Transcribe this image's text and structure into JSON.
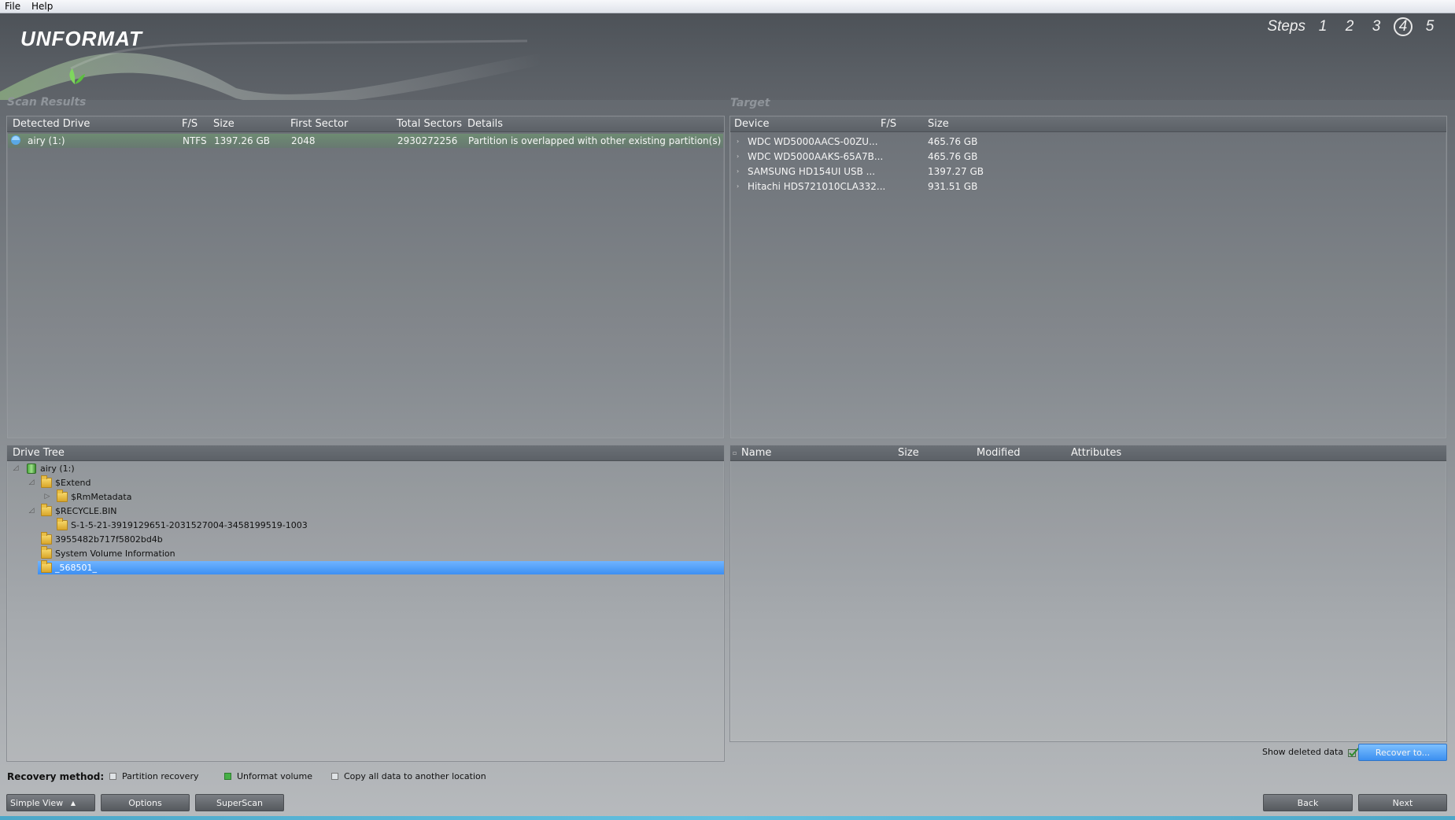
{
  "menu": {
    "file": "File",
    "help": "Help"
  },
  "header": {
    "logo": "UNFORMAT",
    "steps_label": "Steps",
    "steps": [
      "1",
      "2",
      "3",
      "4",
      "5"
    ],
    "current_step": "4"
  },
  "scan_results": {
    "title": "Scan Results",
    "columns": [
      "Detected Drive",
      "F/S",
      "Size",
      "First Sector",
      "Total Sectors",
      "Details"
    ],
    "rows": [
      {
        "drive": "airy (1:)",
        "fs": "NTFS",
        "size": "1397.26 GB",
        "first_sector": "2048",
        "total_sectors": "2930272256",
        "details": "Partition is overlapped with other existing partition(s)"
      }
    ]
  },
  "target": {
    "title": "Target",
    "columns": [
      "Device",
      "F/S",
      "Size"
    ],
    "rows": [
      {
        "device": "WDC WD5000AACS-00ZU...",
        "fs": "",
        "size": "465.76 GB"
      },
      {
        "device": "WDC WD5000AAKS-65A7B...",
        "fs": "",
        "size": "465.76 GB"
      },
      {
        "device": "SAMSUNG HD154UI USB ...",
        "fs": "",
        "size": "1397.27 GB"
      },
      {
        "device": "Hitachi HDS721010CLA332...",
        "fs": "",
        "size": "931.51 GB"
      }
    ]
  },
  "drive_tree": {
    "title": "Drive Tree",
    "nodes": [
      {
        "label": "airy (1:)",
        "toggle": "◿"
      },
      {
        "label": "$Extend",
        "toggle": "◿"
      },
      {
        "label": "$RmMetadata",
        "toggle": "▷"
      },
      {
        "label": "$RECYCLE.BIN",
        "toggle": "◿"
      },
      {
        "label": "S-1-5-21-3919129651-2031527004-3458199519-1003",
        "toggle": ""
      },
      {
        "label": "3955482b717f5802bd4b",
        "toggle": ""
      },
      {
        "label": "System Volume Information",
        "toggle": ""
      },
      {
        "label": "_568501_",
        "toggle": ""
      }
    ]
  },
  "files": {
    "columns": [
      "Name",
      "Size",
      "Modified",
      "Attributes"
    ]
  },
  "show_deleted": "Show deleted data",
  "recovery": {
    "label": "Recovery method:",
    "options": [
      "Partition recovery",
      "Unformat volume",
      "Copy all data to another location"
    ],
    "selected": "Unformat volume"
  },
  "buttons": {
    "simple_view": "Simple View",
    "options": "Options",
    "superscan": "SuperScan",
    "recover_to": "Recover to...",
    "back": "Back",
    "next": "Next"
  }
}
